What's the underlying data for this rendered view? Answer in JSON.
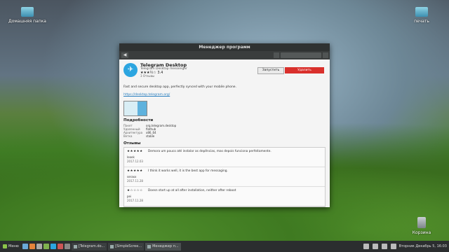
{
  "desktop": {
    "icons": [
      {
        "label": "Домашняя папка"
      },
      {
        "label": "печать"
      },
      {
        "label": "Корзина"
      }
    ]
  },
  "window": {
    "title": "Менеджер программ",
    "back_label": "◀",
    "app": {
      "name": "Telegram Desktop",
      "subtitle": "Telegram Desktop messenger",
      "rating": "★★★½☆ 3.4",
      "reviews_count": "3 Отзывы",
      "launch_label": "Запустить",
      "remove_label": "Удалить",
      "description": "Fast and secure desktop app, perfectly synced with your mobile phone.",
      "link": "https://desktop.telegram.org/"
    },
    "details": {
      "heading": "Подробности",
      "rows": [
        {
          "key": "Пакет",
          "value": "org.telegram.desktop"
        },
        {
          "key": "Удаленный",
          "value": "flathub"
        },
        {
          "key": "Архитектура",
          "value": "x86_64"
        },
        {
          "key": "Ветка",
          "value": "stable"
        }
      ]
    },
    "reviews": {
      "heading": "Отзывы",
      "items": [
        {
          "stars": "★★★★★",
          "text": "Demora um pouco até instalar as depências, mas depois funciona perfeitamente.",
          "user": "leoek",
          "date": "2017.12.03"
        },
        {
          "stars": "★★★★★",
          "text": "I think it works well, it is the best app for messaging.",
          "user": "seraxx",
          "date": "2017.11.28"
        },
        {
          "stars": "★☆☆☆☆",
          "text": "Doesn start up at all after installation, neither after reboot",
          "user": "pei",
          "date": "2017.11.28"
        }
      ]
    }
  },
  "taskbar": {
    "menu_label": "Меню",
    "tasks": [
      {
        "label": "[Telegram.do..."
      },
      {
        "label": "[SimpleScree..."
      },
      {
        "label": "Менеджер п..."
      }
    ],
    "clock": "Вторник Декабрь 5, 16:03"
  }
}
